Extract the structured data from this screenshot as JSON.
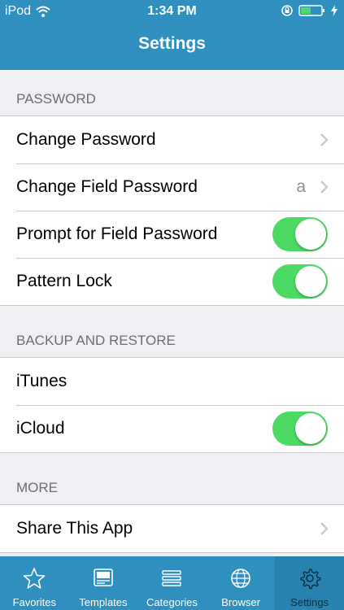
{
  "status_bar": {
    "carrier": "iPod",
    "time": "1:34 PM",
    "icons": [
      "wifi-icon",
      "rotation-lock-icon",
      "battery-icon",
      "charging-icon"
    ]
  },
  "nav": {
    "title": "Settings"
  },
  "sections": [
    {
      "header": "PASSWORD",
      "rows": [
        {
          "label": "Change Password",
          "accessory": "chevron"
        },
        {
          "label": "Change Field Password",
          "detail": "a",
          "accessory": "chevron"
        },
        {
          "label": "Prompt for Field Password",
          "accessory": "toggle",
          "on": true
        },
        {
          "label": "Pattern Lock",
          "accessory": "toggle",
          "on": true
        }
      ]
    },
    {
      "header": "BACKUP AND RESTORE",
      "rows": [
        {
          "label": "iTunes"
        },
        {
          "label": "iCloud",
          "accessory": "toggle",
          "on": true
        }
      ]
    },
    {
      "header": "MORE",
      "rows": [
        {
          "label": "Share This App",
          "accessory": "chevron"
        }
      ]
    }
  ],
  "tabbar": {
    "selected": "Settings",
    "tabs": [
      {
        "label": "Favorites",
        "icon": "star-icon"
      },
      {
        "label": "Templates",
        "icon": "templates-icon"
      },
      {
        "label": "Categories",
        "icon": "list-icon"
      },
      {
        "label": "Browser",
        "icon": "globe-icon"
      },
      {
        "label": "Settings",
        "icon": "gear-icon"
      }
    ]
  },
  "colors": {
    "nav_bar": "#2f8fbf",
    "toggle_on": "#4cd964",
    "section_background": "#efeff4",
    "selected_tab": "#0a2e40"
  }
}
